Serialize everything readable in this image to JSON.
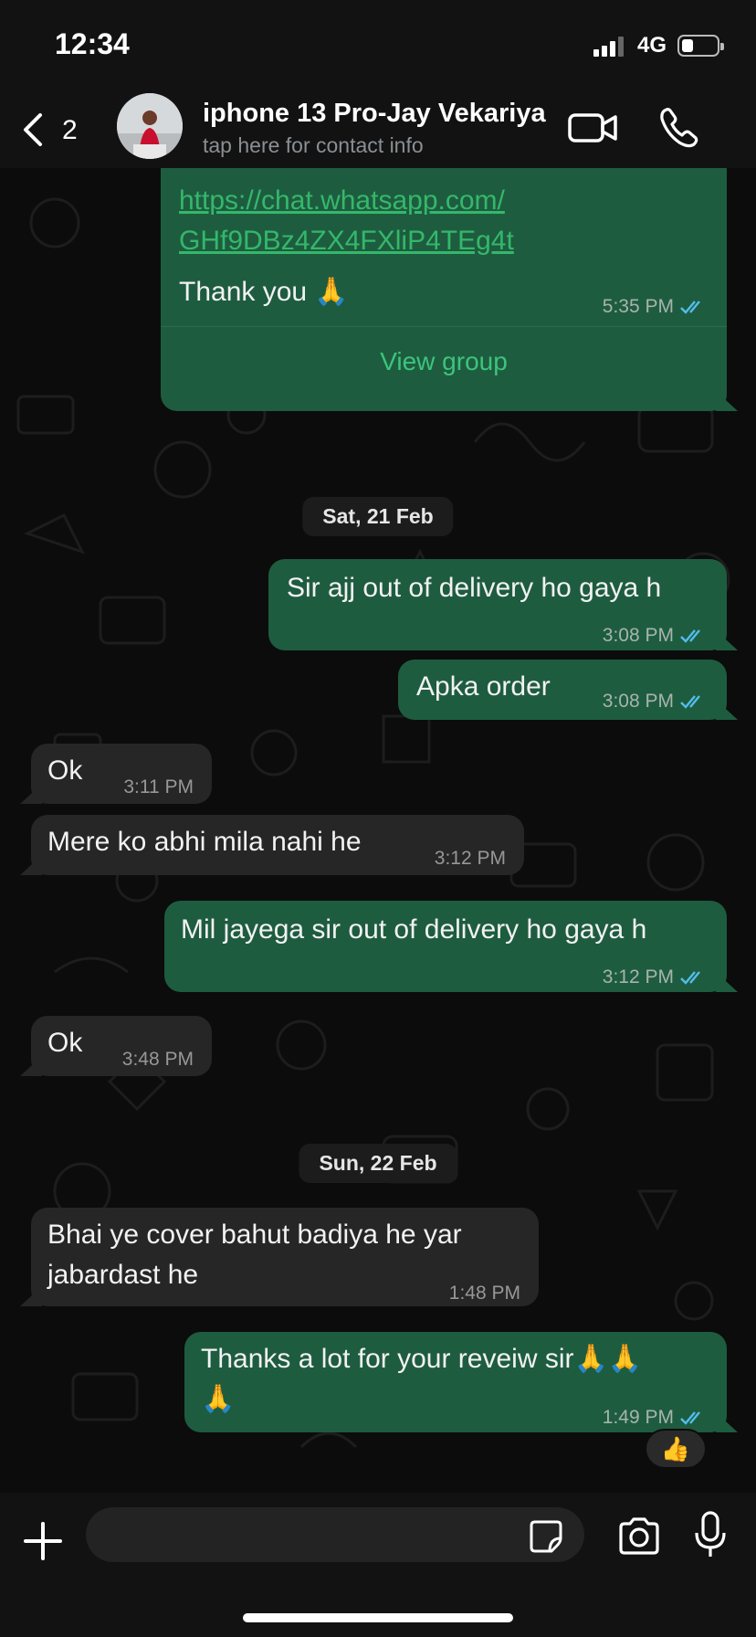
{
  "status_bar": {
    "time": "12:34",
    "network": "4G"
  },
  "header": {
    "back_count": "2",
    "contact_name": "iphone 13 Pro-Jay Vekariya",
    "contact_subtitle": "tap here for contact info"
  },
  "messages": {
    "m0": {
      "link_line1": "https://chat.whatsapp.com/",
      "link_line2": "GHf9DBz4ZX4FXliP4TEg4t",
      "text": "Thank you 🙏",
      "time": "5:35 PM",
      "action": "View group"
    },
    "date1": "Sat, 21 Feb",
    "m1": {
      "text": "Sir ajj out of delivery ho gaya h",
      "time": "3:08 PM"
    },
    "m2": {
      "text": "Apka order",
      "time": "3:08 PM"
    },
    "m3": {
      "text": "Ok",
      "time": "3:11 PM"
    },
    "m4": {
      "text": "Mere ko abhi mila nahi he",
      "time": "3:12 PM"
    },
    "m5": {
      "text": "Mil jayega sir out of delivery ho gaya h",
      "time": "3:12 PM"
    },
    "m6": {
      "text": "Ok",
      "time": "3:48 PM"
    },
    "date2": "Sun, 22 Feb",
    "m7": {
      "line1": "Bhai ye cover bahut badiya he yar",
      "line2": "jabardast he",
      "time": "1:48 PM"
    },
    "m8": {
      "line1": "Thanks a lot for your reveiw sir🙏🙏",
      "line2": "🙏",
      "time": "1:49 PM",
      "reaction": "👍"
    }
  },
  "composer": {
    "placeholder": ""
  },
  "colors": {
    "outgoing_bubble": "#1e5c40",
    "incoming_bubble": "#262626",
    "link": "#34b86a",
    "read_ticks": "#53bdeb"
  }
}
